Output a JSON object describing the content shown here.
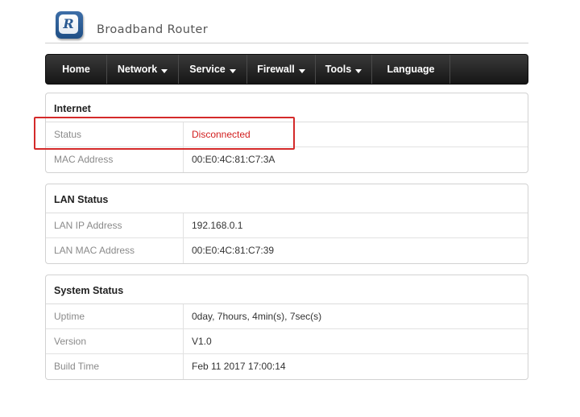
{
  "header": {
    "logo_letter": "R",
    "brand": "Broadband Router"
  },
  "nav": {
    "items": [
      {
        "label": "Home",
        "dropdown": false
      },
      {
        "label": "Network",
        "dropdown": true
      },
      {
        "label": "Service",
        "dropdown": true
      },
      {
        "label": "Firewall",
        "dropdown": true
      },
      {
        "label": "Tools",
        "dropdown": true
      },
      {
        "label": "Language",
        "dropdown": false
      }
    ]
  },
  "internet": {
    "title": "Internet",
    "status_label": "Status",
    "status_value": "Disconnected",
    "mac_label": "MAC Address",
    "mac_value": "00:E0:4C:81:C7:3A"
  },
  "lan": {
    "title": "LAN Status",
    "ip_label": "LAN IP Address",
    "ip_value": "192.168.0.1",
    "mac_label": "LAN MAC Address",
    "mac_value": "00:E0:4C:81:C7:39"
  },
  "system": {
    "title": "System Status",
    "uptime_label": "Uptime",
    "uptime_value": "0day, 7hours, 4min(s), 7sec(s)",
    "version_label": "Version",
    "version_value": "V1.0",
    "build_label": "Build Time",
    "build_value": "Feb 11 2017 17:00:14"
  },
  "colors": {
    "status_alert": "#d21e1e",
    "highlight_box": "#d42a2a",
    "navbar": "#222222"
  }
}
